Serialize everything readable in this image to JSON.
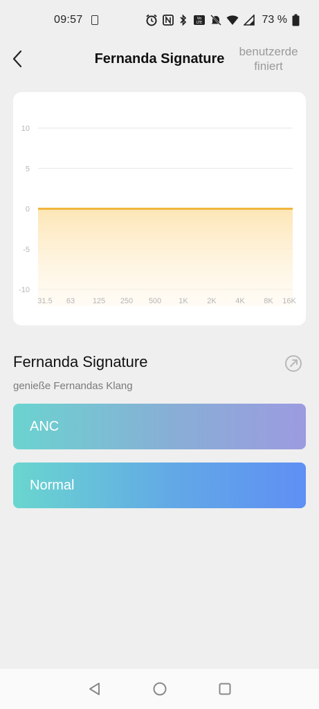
{
  "status": {
    "time": "09:57",
    "battery_percent": "73 %",
    "icons": [
      "sim-icon",
      "alarm-icon",
      "nfc-icon",
      "bluetooth-icon",
      "volte-icon",
      "mute-icon",
      "wifi-icon",
      "signal-icon",
      "battery-icon"
    ]
  },
  "header": {
    "title": "Fernanda Signature",
    "right_line1": "benutzerde",
    "right_line2": "finiert"
  },
  "chart_data": {
    "type": "area",
    "x": [
      "31.5",
      "63",
      "125",
      "250",
      "500",
      "1K",
      "2K",
      "4K",
      "8K",
      "16K"
    ],
    "y_ticks": [
      "10",
      "5",
      "0",
      "-5",
      "-10"
    ],
    "values": [
      0,
      0,
      0,
      0,
      0,
      0,
      0,
      0,
      0,
      0
    ],
    "ylim": [
      -10,
      10
    ],
    "grid": true,
    "line_color": "#f2b53c"
  },
  "preset": {
    "title": "Fernanda Signature",
    "subtitle": "genieße Fernandas Klang"
  },
  "modes": {
    "anc": "ANC",
    "normal": "Normal"
  }
}
